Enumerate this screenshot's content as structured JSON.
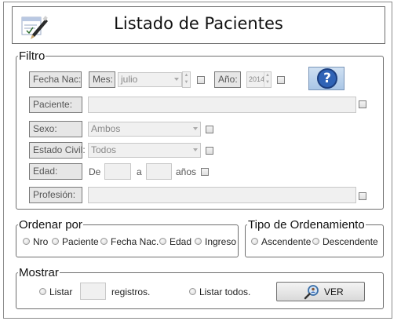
{
  "header": {
    "title": "Listado de Pacientes",
    "logo_icon": "pen-paper-icon"
  },
  "filtro": {
    "legend": "Filtro",
    "fecha_nac_label": "Fecha Nac:",
    "mes_label": "Mes:",
    "mes_value": "julio",
    "anio_label": "Año:",
    "anio_value": "2014",
    "paciente_label": "Paciente:",
    "paciente_value": "",
    "sexo_label": "Sexo:",
    "sexo_value": "Ambos",
    "estado_civil_label": "Estado Civil:",
    "estado_civil_value": "Todos",
    "edad_label": "Edad:",
    "edad_de": "De",
    "edad_a": "a",
    "edad_anios": "años",
    "edad_desde_value": "",
    "edad_hasta_value": "",
    "profesion_label": "Profesión:",
    "profesion_value": "",
    "help_icon": "question-icon"
  },
  "ordenar": {
    "legend": "Ordenar por",
    "options": [
      "Nro",
      "Paciente",
      "Fecha Nac.",
      "Edad",
      "Ingreso"
    ]
  },
  "tipo": {
    "legend": "Tipo de Ordenamiento",
    "options": [
      "Ascendente",
      "Descendente"
    ]
  },
  "mostrar": {
    "legend": "Mostrar",
    "listar": "Listar",
    "registros_value": "",
    "registros": "registros.",
    "listar_todos": "Listar todos.",
    "ver_button": "VER",
    "ver_icon": "magnifier-person-icon"
  },
  "colors": {
    "help_blue": "#2f63b6",
    "disabled_bg": "#f0f0f0",
    "label_bg": "#e6e6e6"
  }
}
